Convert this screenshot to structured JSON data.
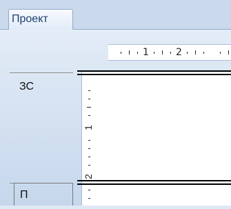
{
  "tabs": [
    {
      "label": "Проект",
      "active": true
    }
  ],
  "horizontal_ruler": {
    "labels": [
      "1",
      "2"
    ]
  },
  "vertical_ruler": {
    "labels": [
      "1",
      "2"
    ]
  },
  "rows": [
    {
      "label": "ЗС"
    },
    {
      "label": "П"
    }
  ],
  "colors": {
    "tab_bar": "#cad9ec",
    "panel": "#dfe9f5",
    "ruler": "#ffffff",
    "accent_border": "#8fa9cb"
  }
}
